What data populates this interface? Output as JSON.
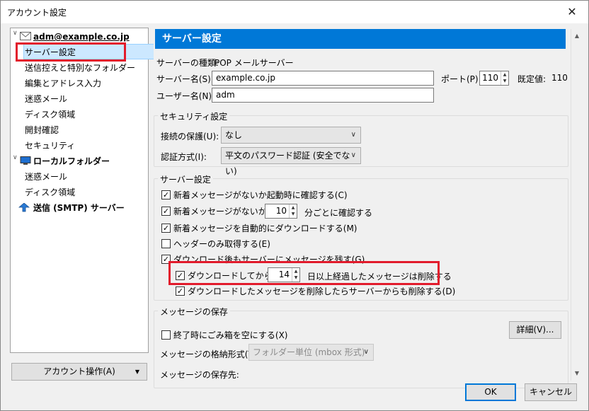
{
  "window": {
    "title": "アカウント設定",
    "close": "✕"
  },
  "sidebar": {
    "account": "adm@example.co.jp",
    "account_items": [
      "サーバー設定",
      "送信控えと特別なフォルダー",
      "編集とアドレス入力",
      "迷惑メール",
      "ディスク領域",
      "開封確認",
      "セキュリティ"
    ],
    "local": "ローカルフォルダー",
    "local_items": [
      "迷惑メール",
      "ディスク領域"
    ],
    "smtp": "送信 (SMTP) サーバー",
    "account_actions": "アカウント操作(A)"
  },
  "header": {
    "title": "サーバー設定"
  },
  "server": {
    "type_label": "サーバーの種類:",
    "type_value": "POP メールサーバー",
    "name_label": "サーバー名(S):",
    "name_value": "example.co.jp",
    "port_label": "ポート(P):",
    "port_value": "110",
    "default_label": "既定値:",
    "default_value": "110",
    "user_label": "ユーザー名(N):",
    "user_value": "adm"
  },
  "security": {
    "group_title": "セキュリティ設定",
    "conn_label": "接続の保護(U):",
    "conn_value": "なし",
    "auth_label": "認証方式(I):",
    "auth_value": "平文のパスワード認証 (安全でない)"
  },
  "server_settings": {
    "group_title": "サーバー設定",
    "check_startup": "新着メッセージがないか起動時に確認する(C)",
    "check_every_pre": "新着メッセージがないか(Y)",
    "check_every_value": "10",
    "check_every_post": "分ごとに確認する",
    "auto_download": "新着メッセージを自動的にダウンロードする(M)",
    "headers_only": "ヘッダーのみ取得する(E)",
    "leave_on_server": "ダウンロード後もサーバーにメッセージを残す(G)",
    "delete_after_pre": "ダウンロードしてから(O)",
    "delete_after_value": "14",
    "delete_after_post": "日以上経過したメッセージは削除する",
    "delete_sync": "ダウンロードしたメッセージを削除したらサーバーからも削除する(D)"
  },
  "storage": {
    "group_title": "メッセージの保存",
    "empty_trash": "終了時にごみ箱を空にする(X)",
    "details_button": "詳細(V)...",
    "format_label": "メッセージの格納形式(T):",
    "format_value": "フォルダー単位 (mbox 形式)",
    "location_label": "メッセージの保存先:"
  },
  "footer": {
    "ok": "OK",
    "cancel": "キャンセル"
  },
  "colors": {
    "accent": "#0078d7",
    "highlight": "#e21b2c",
    "selection": "#cce8ff"
  }
}
